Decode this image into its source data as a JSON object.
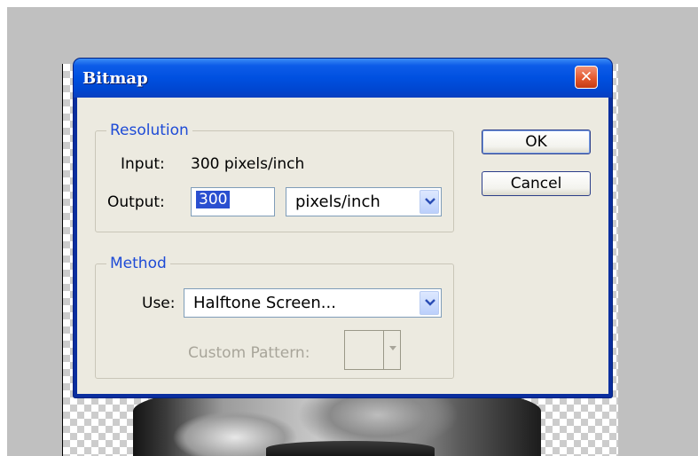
{
  "dialog": {
    "title": "Bitmap",
    "close_icon": "close-icon",
    "resolution": {
      "legend": "Resolution",
      "input_label": "Input:",
      "input_value": "300 pixels/inch",
      "output_label": "Output:",
      "output_value": "300",
      "unit_selected": "pixels/inch"
    },
    "method": {
      "legend": "Method",
      "use_label": "Use:",
      "use_selected": "Halftone Screen...",
      "custom_pattern_label": "Custom Pattern:"
    },
    "buttons": {
      "ok": "OK",
      "cancel": "Cancel"
    }
  },
  "colors": {
    "title_bar": "#0050e0",
    "close_button": "#e3592f",
    "group_legend": "#1e4bd6",
    "dialog_face": "#eceae0"
  }
}
